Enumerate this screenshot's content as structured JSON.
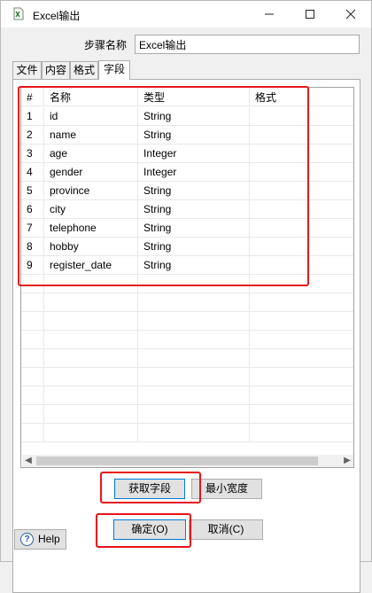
{
  "window": {
    "title": "Excel输出",
    "icon": "excel-output-step-icon",
    "controls": {
      "minimize": "minimize-icon",
      "maximize": "maximize-icon",
      "close": "close-icon"
    }
  },
  "step_name": {
    "label": "步骤名称",
    "value": "Excel输出"
  },
  "tabs": [
    {
      "label": "文件",
      "active": false
    },
    {
      "label": "内容",
      "active": false
    },
    {
      "label": "格式",
      "active": false
    },
    {
      "label": "字段",
      "active": true
    }
  ],
  "fields_table": {
    "columns": [
      "#",
      "名称",
      "类型",
      "格式"
    ],
    "rows": [
      [
        "1",
        "id",
        "String",
        ""
      ],
      [
        "2",
        "name",
        "String",
        ""
      ],
      [
        "3",
        "age",
        "Integer",
        ""
      ],
      [
        "4",
        "gender",
        "Integer",
        ""
      ],
      [
        "5",
        "province",
        "String",
        ""
      ],
      [
        "6",
        "city",
        "String",
        ""
      ],
      [
        "7",
        "telephone",
        "String",
        ""
      ],
      [
        "8",
        "hobby",
        "String",
        ""
      ],
      [
        "9",
        "register_date",
        "String",
        ""
      ]
    ]
  },
  "buttons": {
    "get_fields": "获取字段",
    "min_width": "最小宽度",
    "ok": "确定(O)",
    "cancel": "取消(C)",
    "help": "Help"
  },
  "colors": {
    "highlight_box": "#e8141a",
    "focus_border": "#0078d7"
  }
}
